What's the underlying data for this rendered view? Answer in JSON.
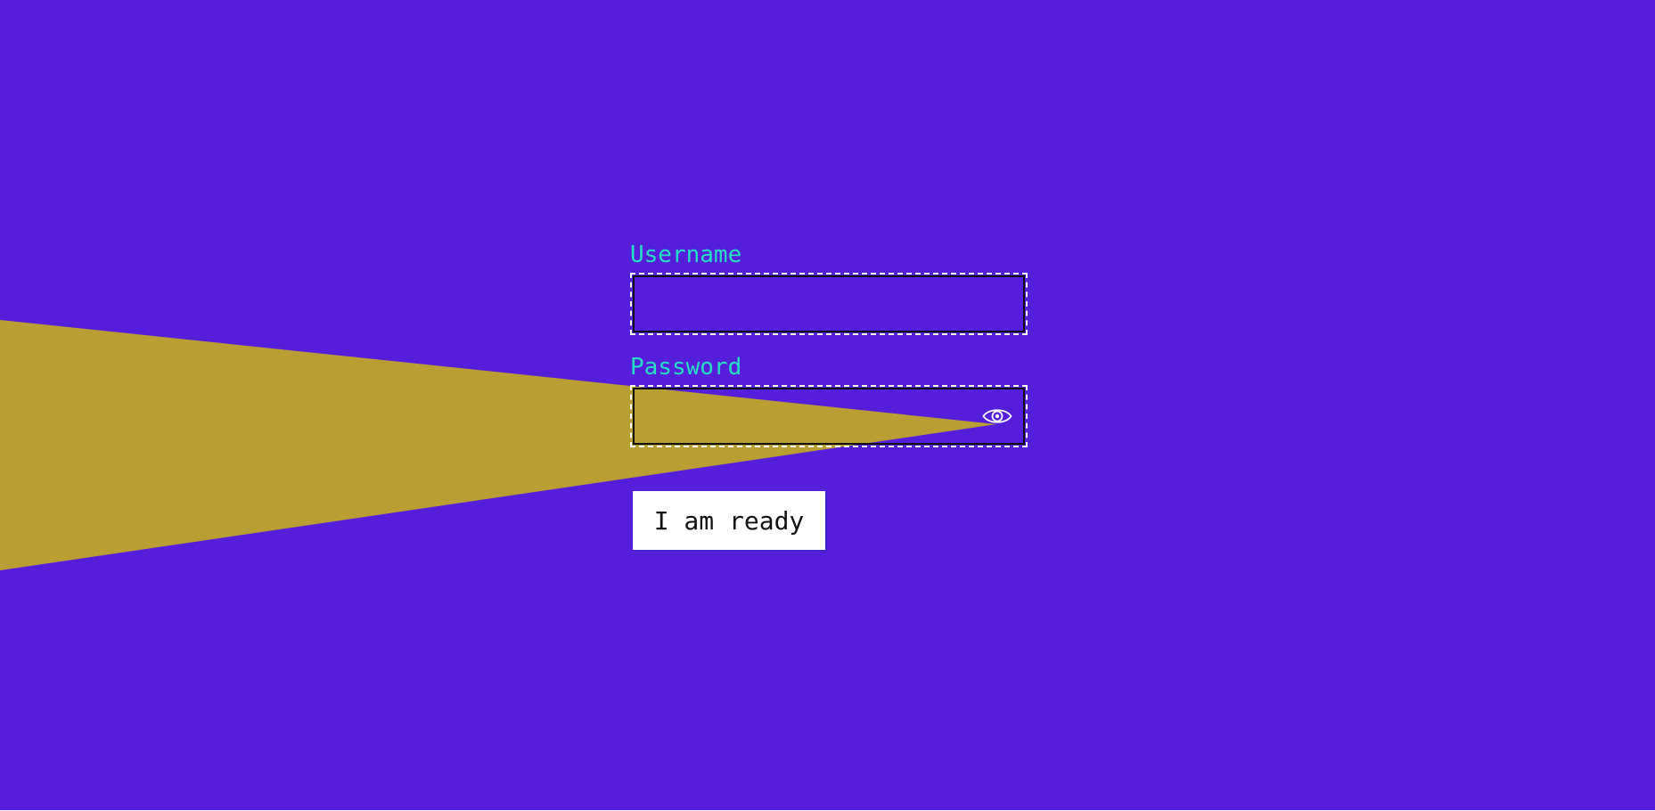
{
  "colors": {
    "background": "#551edb",
    "beam": "#b99f33",
    "label": "#24e0c2",
    "field_border": "#101010",
    "field_outline": "#ffffff",
    "button_background": "#ffffff",
    "button_text": "#111111"
  },
  "form": {
    "username": {
      "label": "Username",
      "value": "",
      "placeholder": ""
    },
    "password": {
      "label": "Password",
      "value": "",
      "placeholder": "",
      "visibility_toggle_icon": "eye-icon"
    },
    "submit_label": "I am ready"
  }
}
